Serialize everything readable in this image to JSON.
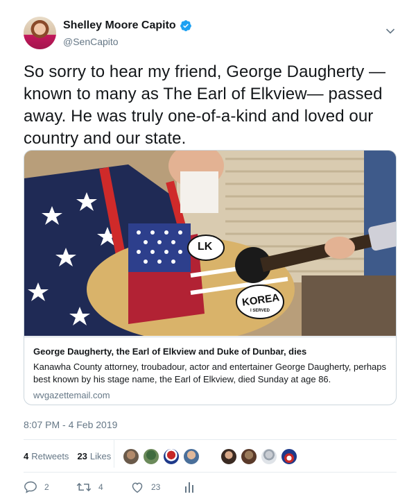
{
  "tweet": {
    "author": {
      "display_name": "Shelley Moore Capito",
      "handle": "@SenCapito",
      "verified": true,
      "avatar_icon": "avatar-photo"
    },
    "text": "So sorry to hear my friend, George Daugherty —known to many as The Earl of Elkview— passed away. He was truly one-of-a-kind and loved our country and our state.",
    "link_card": {
      "image_subject": "musician-with-flag-guitar-photo",
      "image_text": {
        "sticker_1": "LK",
        "sticker_2": "KOREA",
        "sticker_2_sub": "I SERVED"
      },
      "title": "George Daugherty, the Earl of Elkview and Duke of Dunbar, dies",
      "description": "Kanawha County attorney, troubadour, actor and entertainer George Daugherty, perhaps best known by his stage name, the Earl of Elkview, died Sunday at age 86.",
      "domain": "wvgazettemail.com"
    },
    "timestamp": "8:07 PM - 4 Feb 2019",
    "stats": {
      "retweets_count": "4",
      "retweets_label": "Retweets",
      "likes_count": "23",
      "likes_label": "Likes"
    },
    "liker_avatars": [
      "avatar-1",
      "avatar-2",
      "avatar-3",
      "avatar-4",
      "avatar-5",
      "avatar-6",
      "avatar-7",
      "avatar-8"
    ],
    "actions": {
      "reply_count": "2",
      "retweet_count": "4",
      "like_count": "23",
      "analytics_icon": "bar-chart-icon"
    },
    "colors": {
      "verified_blue": "#1da1f2",
      "text_primary": "#14171a",
      "text_secondary": "#657786",
      "border": "#ccd6dd"
    }
  }
}
